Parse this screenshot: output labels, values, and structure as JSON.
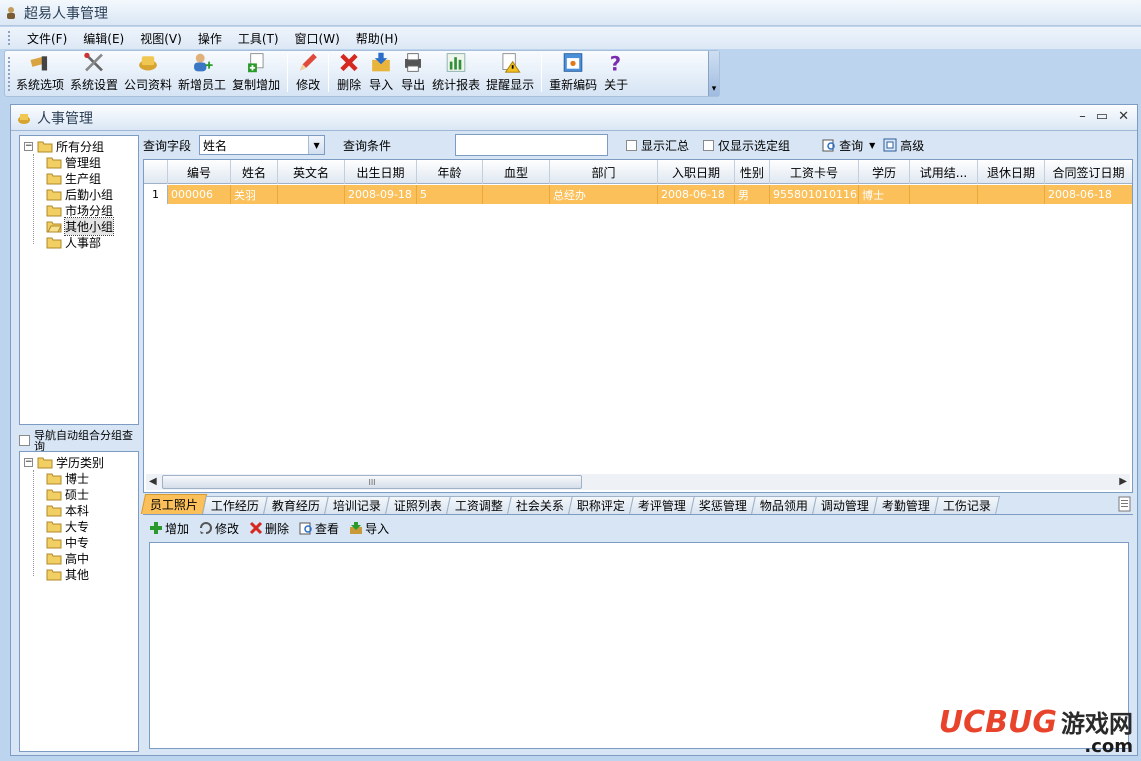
{
  "app": {
    "title": "超易人事管理"
  },
  "menu": [
    {
      "label": "文件(F)"
    },
    {
      "label": "编辑(E)"
    },
    {
      "label": "视图(V)"
    },
    {
      "label": "操作"
    },
    {
      "label": "工具(T)"
    },
    {
      "label": "窗口(W)"
    },
    {
      "label": "帮助(H)"
    }
  ],
  "toolbar": {
    "buttons": [
      {
        "label": "系统选项",
        "icon": "system-options-icon"
      },
      {
        "label": "系统设置",
        "icon": "tools-icon"
      },
      {
        "label": "公司资料",
        "icon": "company-icon"
      },
      {
        "label": "新增员工",
        "icon": "add-user-icon"
      },
      {
        "label": "复制增加",
        "icon": "copy-add-icon"
      },
      {
        "label": "修改",
        "icon": "pencil-icon"
      },
      {
        "label": "删除",
        "icon": "delete-icon"
      },
      {
        "label": "导入",
        "icon": "import-icon"
      },
      {
        "label": "导出",
        "icon": "export-icon"
      },
      {
        "label": "统计报表",
        "icon": "chart-icon"
      },
      {
        "label": "提醒显示",
        "icon": "reminder-icon"
      },
      {
        "label": "重新编码",
        "icon": "recode-icon"
      },
      {
        "label": "关于",
        "icon": "help-icon"
      }
    ]
  },
  "panel": {
    "title": "人事管理"
  },
  "groups_tree": {
    "root": "所有分组",
    "items": [
      "管理组",
      "生产组",
      "后勤小组",
      "市场分组",
      "其他小组",
      "人事部"
    ],
    "selected": "其他小组"
  },
  "nav_check": {
    "label": "导航自动组合分组查询"
  },
  "edu_tree": {
    "root": "学历类别",
    "items": [
      "博士",
      "硕士",
      "本科",
      "大专",
      "中专",
      "高中",
      "其他"
    ]
  },
  "query": {
    "field_label": "查询字段",
    "field_value": "姓名",
    "condition_label": "查询条件",
    "condition_value": "",
    "show_summary": "显示汇总",
    "only_selected": "仅显示选定组",
    "search_btn": "查询",
    "advanced_btn": "高级"
  },
  "grid": {
    "columns": [
      "编号",
      "姓名",
      "英文名",
      "出生日期",
      "年龄",
      "血型",
      "部门",
      "入职日期",
      "性别",
      "工资卡号",
      "学历",
      "试用结...",
      "退休日期",
      "合同签订日期"
    ],
    "rows": [
      {
        "num": "1",
        "cells": [
          "000006",
          "关羽",
          "",
          "2008-09-18",
          "5",
          "",
          "总经办",
          "2008-06-18",
          "男",
          "955801010116",
          "博士",
          "",
          "",
          "2008-06-18"
        ]
      }
    ],
    "scroll_mark": "III"
  },
  "tabs": [
    "员工照片",
    "工作经历",
    "教育经历",
    "培训记录",
    "证照列表",
    "工资调整",
    "社会关系",
    "职称评定",
    "考评管理",
    "奖惩管理",
    "物品领用",
    "调动管理",
    "考勤管理",
    "工伤记录"
  ],
  "sub_toolbar": [
    {
      "label": "增加",
      "icon": "add-icon"
    },
    {
      "label": "修改",
      "icon": "edit-icon"
    },
    {
      "label": "删除",
      "icon": "delete-icon"
    },
    {
      "label": "查看",
      "icon": "view-icon"
    },
    {
      "label": "导入",
      "icon": "import-icon"
    }
  ],
  "watermark": {
    "brand": "UCBUG",
    "cn": "游戏网",
    "domain": ".com"
  }
}
